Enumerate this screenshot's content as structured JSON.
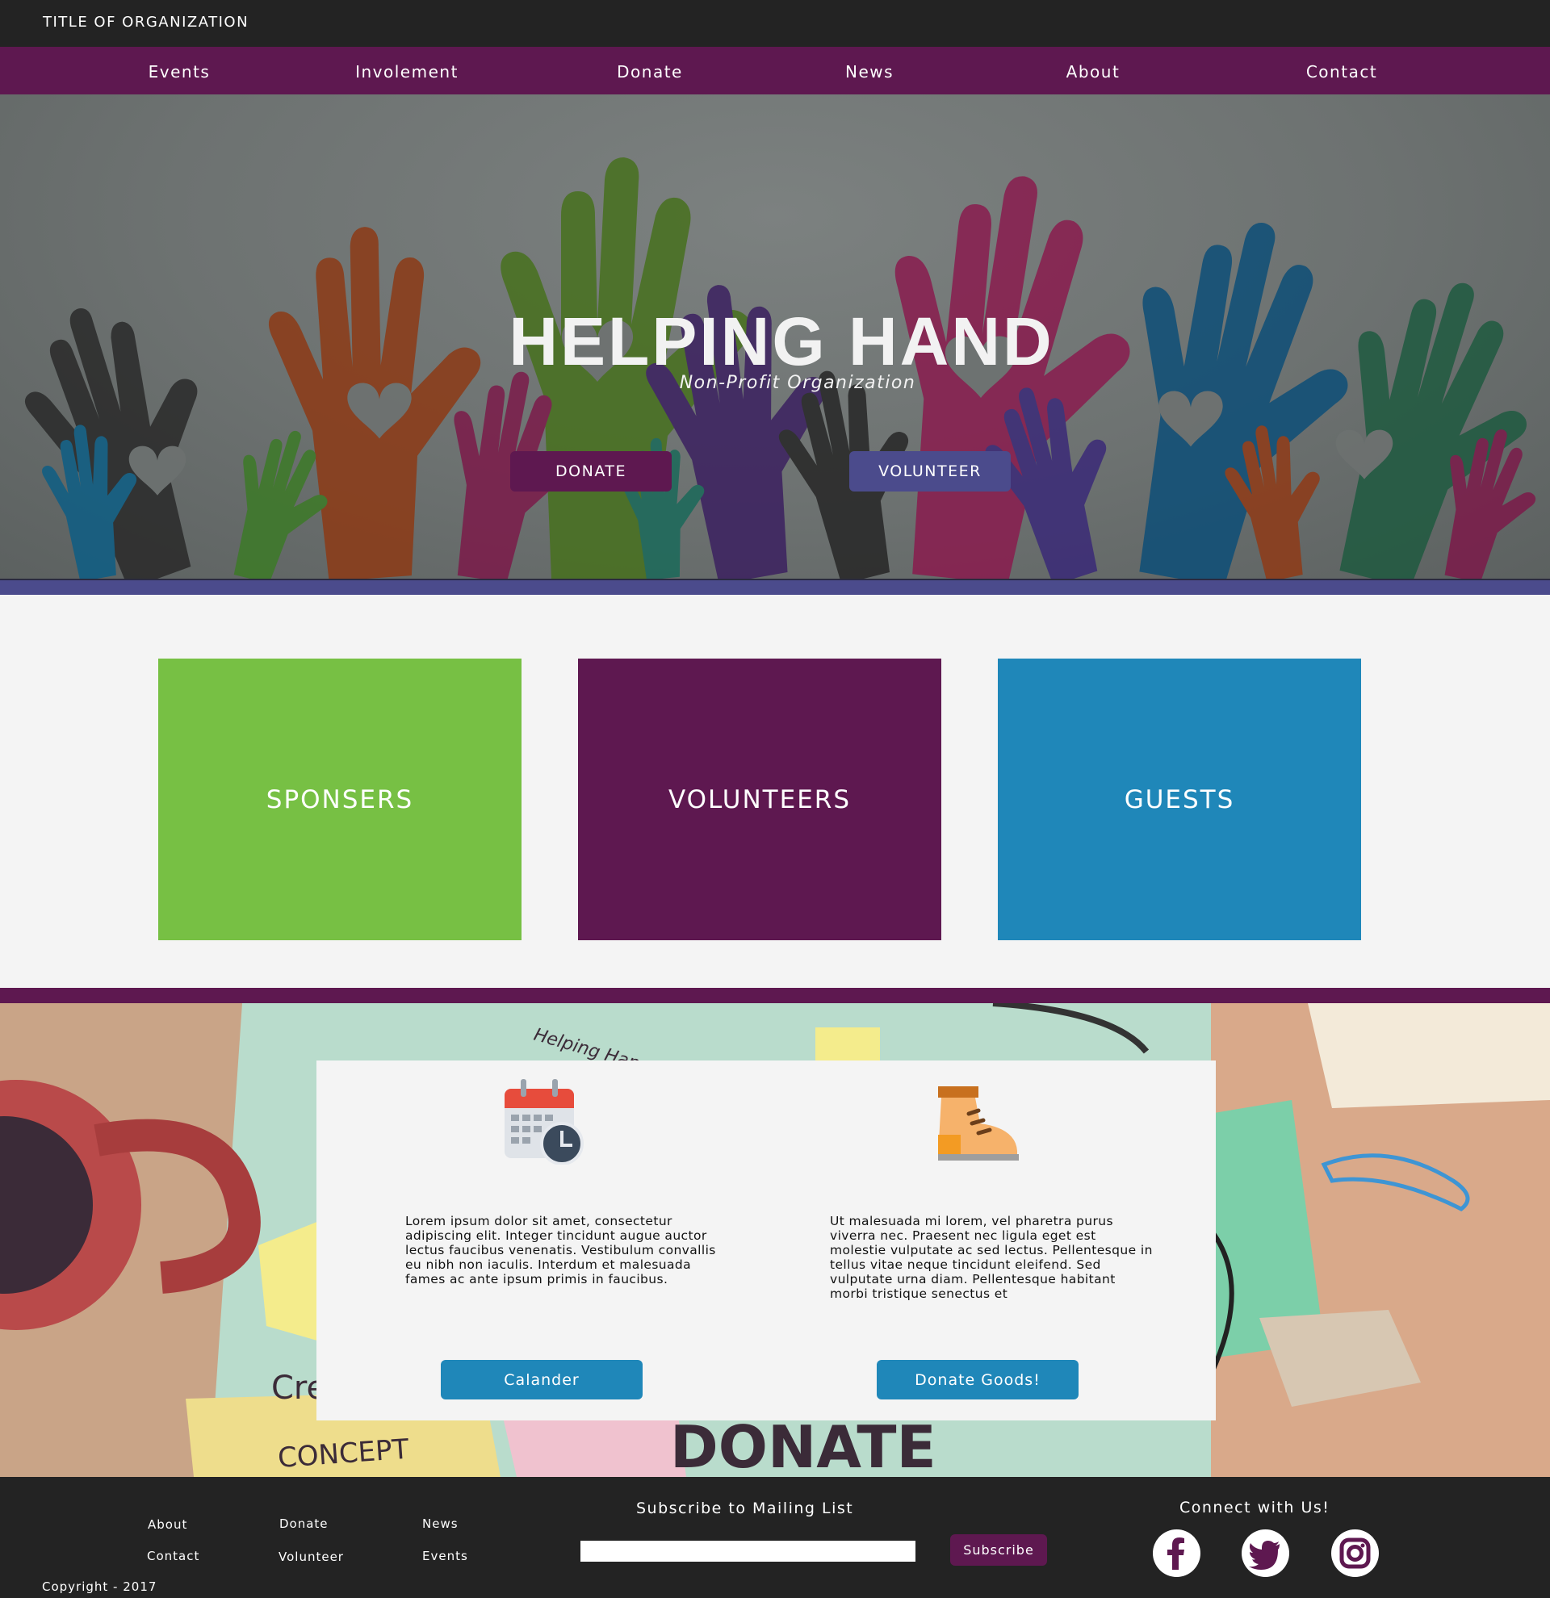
{
  "header": {
    "org_title": "TITLE OF ORGANIZATION"
  },
  "nav": {
    "items": [
      "Events",
      "Involement",
      "Donate",
      "News",
      "About",
      "Contact"
    ]
  },
  "hero": {
    "title": "HELPING HAND",
    "subtitle": "Non-Profit Organization",
    "donate_label": "DONATE",
    "volunteer_label": "VOLUNTEER"
  },
  "cards": [
    {
      "label": "SPONSERS",
      "color": "#77c044"
    },
    {
      "label": "VOLUNTEERS",
      "color": "#5e1850"
    },
    {
      "label": "GUESTS",
      "color": "#1f87b9"
    }
  ],
  "info": {
    "left": {
      "icon": "calendar-clock-icon",
      "text": "Lorem ipsum dolor sit amet, consectetur adipiscing elit. Integer tincidunt augue auctor lectus faucibus venenatis. Vestibulum convallis eu nibh non iaculis. Interdum et malesuada fames ac ante ipsum primis in faucibus.",
      "button": "Calander"
    },
    "right": {
      "icon": "boot-icon",
      "text": "Ut malesuada mi lorem, vel pharetra purus viverra nec. Praesent nec ligula eget est molestie vulputate ac sed lectus. Pellentesque in tellus vitae neque tincidunt eleifend.  Sed vulputate urna diam. Pellentesque habitant morbi tristique senectus et",
      "button": "Donate Goods!"
    },
    "background_text": {
      "helping_hand": "Helping Han",
      "donate": "DONATE",
      "concept": "CONCEPT",
      "cre": "Cre"
    }
  },
  "footer": {
    "links": [
      "About",
      "Donate",
      "News",
      "Contact",
      "Volunteer",
      "Events"
    ],
    "subscribe_title": "Subscribe to Mailing List",
    "subscribe_placeholder": "",
    "subscribe_button": "Subscribe",
    "connect_title": "Connect with Us!",
    "social": [
      "facebook-icon",
      "twitter-icon",
      "instagram-icon"
    ],
    "copyright": "Copyright - 2017"
  },
  "colors": {
    "purple": "#5e1850",
    "blue": "#1f87b9",
    "indigo": "#4b4b8c",
    "green": "#77c044",
    "dark": "#232323"
  }
}
